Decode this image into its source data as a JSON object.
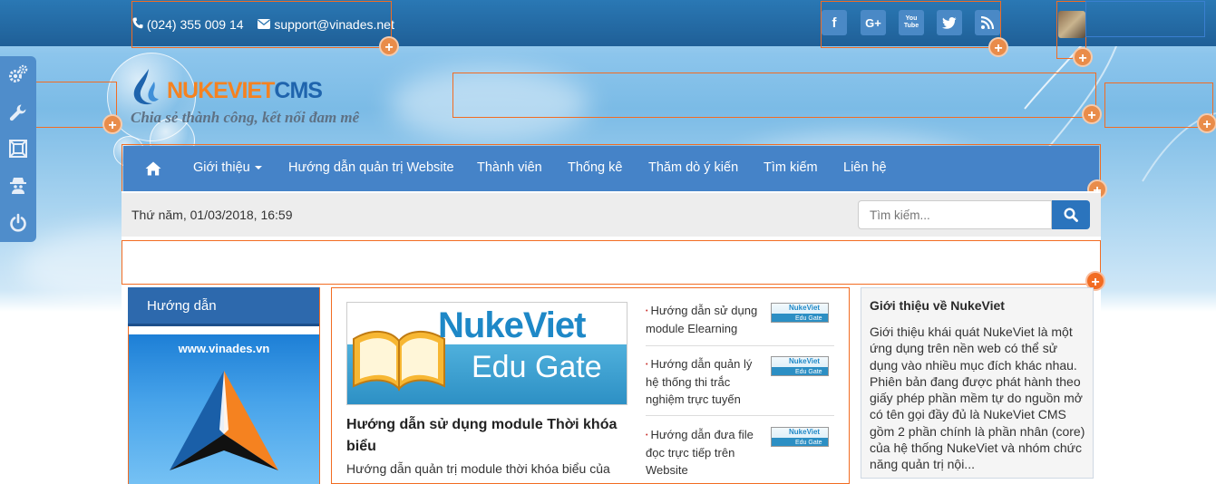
{
  "topbar": {
    "phone": "(024) 355 009 14",
    "email": "support@vinades.net",
    "social": [
      {
        "icon": "facebook-icon",
        "glyph": "f"
      },
      {
        "icon": "google-plus-icon",
        "glyph": "G+"
      },
      {
        "icon": "youtube-icon",
        "glyph": "You Tube"
      },
      {
        "icon": "twitter-icon",
        "glyph": ""
      },
      {
        "icon": "rss-icon",
        "glyph": ""
      }
    ]
  },
  "admin_toolbar": [
    "gears-icon",
    "wrench-icon",
    "layout-icon",
    "user-secret-icon",
    "power-icon"
  ],
  "logo": {
    "brand_main": "NUKEVIET",
    "brand_suffix": "CMS",
    "slogan": "Chia sẻ thành công, kết nối đam mê"
  },
  "nav": {
    "items": [
      {
        "label": "Giới thiệu",
        "has_dropdown": true
      },
      {
        "label": "Hướng dẫn quản trị Website"
      },
      {
        "label": "Thành viên"
      },
      {
        "label": "Thống kê"
      },
      {
        "label": "Thăm dò ý kiến"
      },
      {
        "label": "Tìm kiếm"
      },
      {
        "label": "Liên hệ"
      }
    ]
  },
  "datebar": {
    "date": "Thứ năm, 01/03/2018, 16:59",
    "search_placeholder": "Tìm kiếm..."
  },
  "left": {
    "heading": "Hướng dẫn",
    "banner_text": "www.vinades.vn"
  },
  "main": {
    "featured": {
      "image_brand": "NukeViet",
      "image_sub": "Edu Gate",
      "title": "Hướng dẫn sử dụng module Thời khóa biểu",
      "desc": "Hướng dẫn quản trị module thời khóa biểu của"
    },
    "news": [
      {
        "title": "Hướng dẫn sử dụng module Elearning",
        "thumb_brand": "NukeViet",
        "thumb_sub": "Edu Gate"
      },
      {
        "title": "Hướng dẫn quản lý hệ thống thi trắc nghiệm trực tuyến",
        "thumb_brand": "NukeViet",
        "thumb_sub": "Edu Gate"
      },
      {
        "title": "Hướng dẫn đưa file đọc trực tiếp trên Website",
        "thumb_brand": "NukeViet",
        "thumb_sub": "Edu Gate"
      }
    ]
  },
  "right": {
    "heading": "Giới thiệu về NukeViet",
    "body": "Giới thiệu khái quát NukeViet là một ứng dụng trên nền web có thể sử dụng vào nhiều mục đích khác nhau. Phiên bản đang được phát hành theo giấy phép phần mềm tự do nguồn mở có tên gọi đầy đủ là NukeViet CMS gồm 2 phần chính là phần nhân (core) của hệ thống NukeViet và nhóm chức năng quản trị nội..."
  },
  "colors": {
    "topbar": "#2a78b4",
    "nav": "#4583c8",
    "accent_orange": "#f26c22",
    "search_button": "#2b74bd",
    "left_heading": "#2d69ad"
  }
}
